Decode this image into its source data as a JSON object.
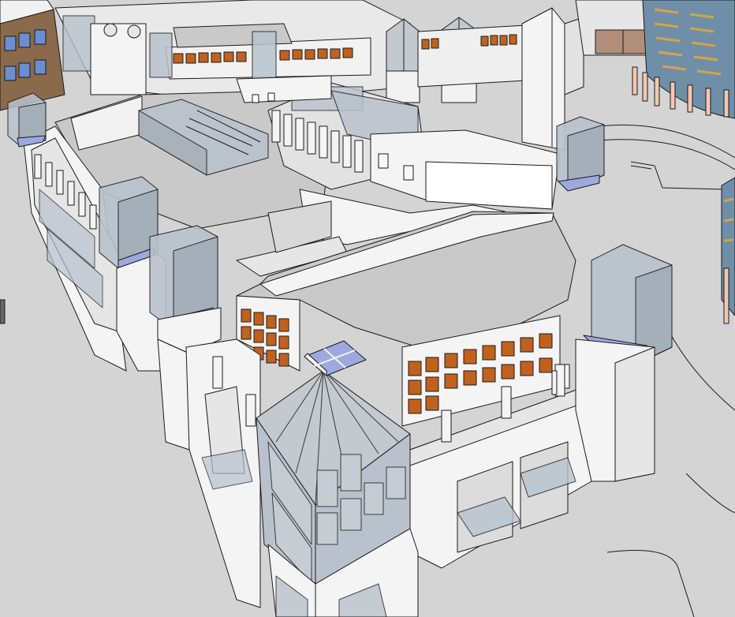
{
  "viewport": {
    "view_type": "3d-perspective-model-view",
    "background_color": "#d4d4d4",
    "colors": {
      "ground": "#d4d4d4",
      "roof": "#c9c9c9",
      "wall_light": "#f4f4f4",
      "wall_shade": "#e2e2e2",
      "edge": "#1a1a1a",
      "glass": "#b9c2cc",
      "glass_tint": "#9ea8e0",
      "window_orange": "#c0621e",
      "brown_facade": "#8a6a4a",
      "blue_window": "#6a8ed0",
      "gold_band": "#d6a347",
      "column_pink": "#f1c7b3"
    }
  }
}
